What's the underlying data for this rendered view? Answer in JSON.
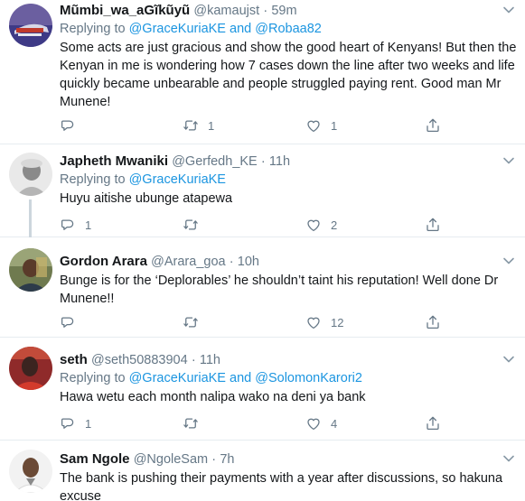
{
  "tweets": [
    {
      "name": "Mũmbi_wa_aGĩkũyũ",
      "handle": "@kamaujst",
      "time": "59m",
      "replying": "Replying to",
      "mention1": "@GraceKuriaKE",
      "conj": "and",
      "mention2": "@Robaa82",
      "text": "Some acts are just gracious and show the good heart of Kenyans! But then the Kenyan in me is wondering how 7 cases down the line after two weeks and life quickly became unbearable and people struggled paying rent. Good man Mr Munene!",
      "replies": "",
      "retweets": "1",
      "likes": "1"
    },
    {
      "name": "Japheth Mwaniki",
      "handle": "@Gerfedh_KE",
      "time": "11h",
      "replying": "Replying to",
      "mention1": "@GraceKuriaKE",
      "text": "Huyu aitishe ubunge atapewa",
      "replies": "1",
      "retweets": "",
      "likes": "2"
    },
    {
      "name": "Gordon Arara",
      "handle": "@Arara_goa",
      "time": "10h",
      "text": "Bunge is for the ‘Deplorables’ he shouldn’t taint his reputation! Well done Dr Munene!!",
      "replies": "",
      "retweets": "",
      "likes": "12"
    },
    {
      "name": "seth",
      "handle": "@seth50883904",
      "time": "11h",
      "replying": "Replying to",
      "mention1": "@GraceKuriaKE",
      "conj": "and",
      "mention2": "@SolomonKarori2",
      "text": "Hawa wetu each month nalipa wako na deni ya bank",
      "replies": "1",
      "retweets": "",
      "likes": "4"
    },
    {
      "name": "Sam Ngole",
      "handle": "@NgoleSam",
      "time": "7h",
      "text": "The bank is pushing their payments with a year  after discussions, so hakuna excuse"
    }
  ],
  "separator": "·",
  "icons": {
    "reply": "reply-icon",
    "retweet": "retweet-icon",
    "like": "like-icon",
    "share": "share-icon",
    "more": "chevron-down-icon"
  },
  "colors": {
    "link": "#1b95e0",
    "secondary": "#657786",
    "text": "#14171a",
    "divider": "#e6ecf0"
  }
}
